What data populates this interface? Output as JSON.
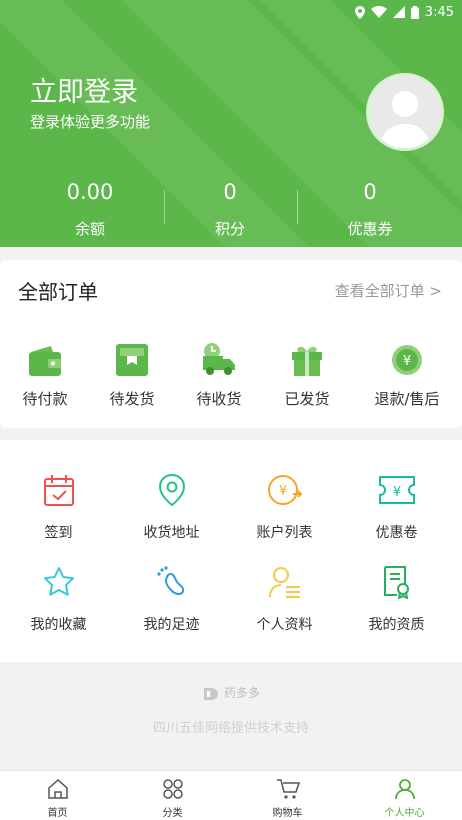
{
  "status_bar": {
    "time": "3:45"
  },
  "header": {
    "title": "立即登录",
    "subtitle": "登录体验更多功能",
    "stats": [
      {
        "value": "0.00",
        "label": "余额"
      },
      {
        "value": "0",
        "label": "积分"
      },
      {
        "value": "0",
        "label": "优惠券"
      }
    ]
  },
  "orders": {
    "title": "全部订单",
    "view_all": "查看全部订单 >",
    "items": [
      {
        "label": "待付款",
        "icon": "wallet-icon"
      },
      {
        "label": "待发货",
        "icon": "package-icon"
      },
      {
        "label": "待收货",
        "icon": "delivery-truck-icon"
      },
      {
        "label": "已发货",
        "icon": "gift-icon"
      },
      {
        "label": "退款/售后",
        "icon": "refund-icon"
      }
    ]
  },
  "tools": [
    {
      "label": "签到",
      "icon": "calendar-check-icon",
      "color": "#ef5350"
    },
    {
      "label": "收货地址",
      "icon": "location-pin-icon",
      "color": "#26c281"
    },
    {
      "label": "账户列表",
      "icon": "yuan-transfer-icon",
      "color": "#f5a623"
    },
    {
      "label": "优惠卷",
      "icon": "yuan-ticket-icon",
      "color": "#1abc9c"
    },
    {
      "label": "我的收藏",
      "icon": "star-icon",
      "color": "#3cc7d8"
    },
    {
      "label": "我的足迹",
      "icon": "footprint-icon",
      "color": "#2d9cdb"
    },
    {
      "label": "个人资料",
      "icon": "person-list-icon",
      "color": "#f2c94c"
    },
    {
      "label": "我的资质",
      "icon": "certificate-icon",
      "color": "#27ae60"
    }
  ],
  "footer": {
    "logo_text": "药多多",
    "support": "四川五佳网络提供技术支持"
  },
  "tabbar": [
    {
      "label": "首页",
      "icon": "home-icon",
      "active": false
    },
    {
      "label": "分类",
      "icon": "category-icon",
      "active": false
    },
    {
      "label": "购物车",
      "icon": "cart-icon",
      "active": false
    },
    {
      "label": "个人中心",
      "icon": "person-icon",
      "active": true
    }
  ],
  "colors": {
    "brand_green": "#5cb74a",
    "active_tab": "#4cae3a"
  }
}
